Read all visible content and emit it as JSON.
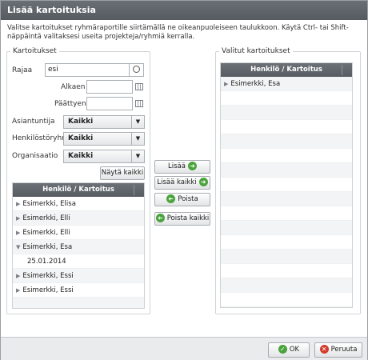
{
  "dialog": {
    "title": "Lisää kartoituksia",
    "description": "Valitse kartoitukset ryhmäraportille siirtämällä ne oikeanpuoleiseen taulukkoon. Käytä Ctrl- tai Shift-näppäintä valitaksesi useita projekteja/ryhmiä kerralla."
  },
  "left": {
    "legend": "Kartoitukset",
    "filter_label": "Rajaa",
    "filter_value": "esi",
    "start_label": "Alkaen",
    "end_label": "Päättyen",
    "expert_label": "Asiantuntija",
    "expert_value": "Kaikki",
    "group_label": "Henkilöstöryhmä",
    "group_value": "Kaikki",
    "org_label": "Organisaatio",
    "org_value": "Kaikki",
    "show_all_label": "Näytä kaikki",
    "table_header": "Henkilö / Kartoitus",
    "rows": [
      "Esimerkki, Elisa",
      "Esimerkki, Elli",
      "Esimerkki, Elli",
      "Esimerkki, Esa",
      "25.01.2014",
      "Esimerkki, Essi",
      "Esimerkki, Essi"
    ]
  },
  "actions": {
    "add": "Lisää",
    "add_all": "Lisää kaikki",
    "remove": "Poista",
    "remove_all": "Poista kaikki"
  },
  "right": {
    "legend": "Valitut kartoitukset",
    "table_header": "Henkilö / Kartoitus",
    "rows": [
      "Esimerkki, Esa"
    ]
  },
  "footer": {
    "ok_label": "OK",
    "cancel_label": "Peruuta"
  },
  "colors": {
    "header_bg": "#575c62",
    "ok_icon": "#4aa33c",
    "cancel_icon": "#d33c2c"
  }
}
